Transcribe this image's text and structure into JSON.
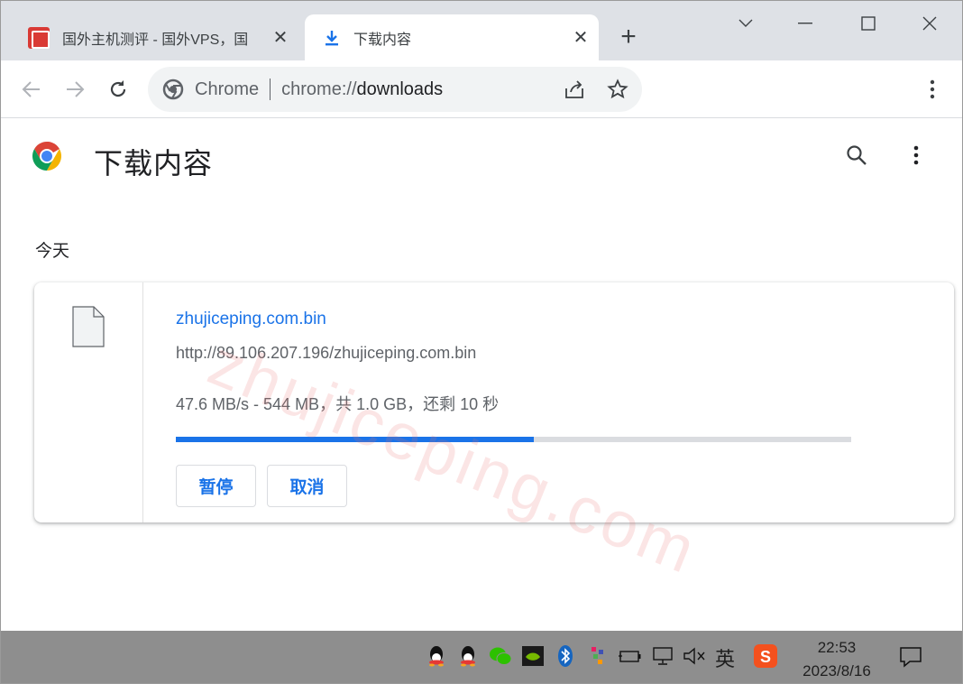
{
  "tabs": [
    {
      "title": "国外主机测评 - 国外VPS，国",
      "close": "✕"
    },
    {
      "title": "下载内容",
      "close": "✕"
    }
  ],
  "newtab_label": "+",
  "omnibox": {
    "site_chip": "Chrome",
    "url_scheme": "chrome://",
    "url_path": "downloads"
  },
  "page": {
    "title": "下载内容",
    "section_today": "今天",
    "watermark": "zhujiceping.com"
  },
  "download": {
    "file_name": "zhujiceping.com.bin",
    "url": "http://89.106.207.196/zhujiceping.com.bin",
    "status": "47.6 MB/s - 544 MB，共 1.0 GB，还剩 10 秒",
    "progress_fraction": 0.53,
    "pause_label": "暂停",
    "cancel_label": "取消"
  },
  "taskbar": {
    "ime": "英",
    "time": "22:53",
    "date": "2023/8/16"
  },
  "colors": {
    "accent": "#1a73e8",
    "tabstrip": "#dee1e6",
    "taskbar": "#8e8e8e"
  }
}
